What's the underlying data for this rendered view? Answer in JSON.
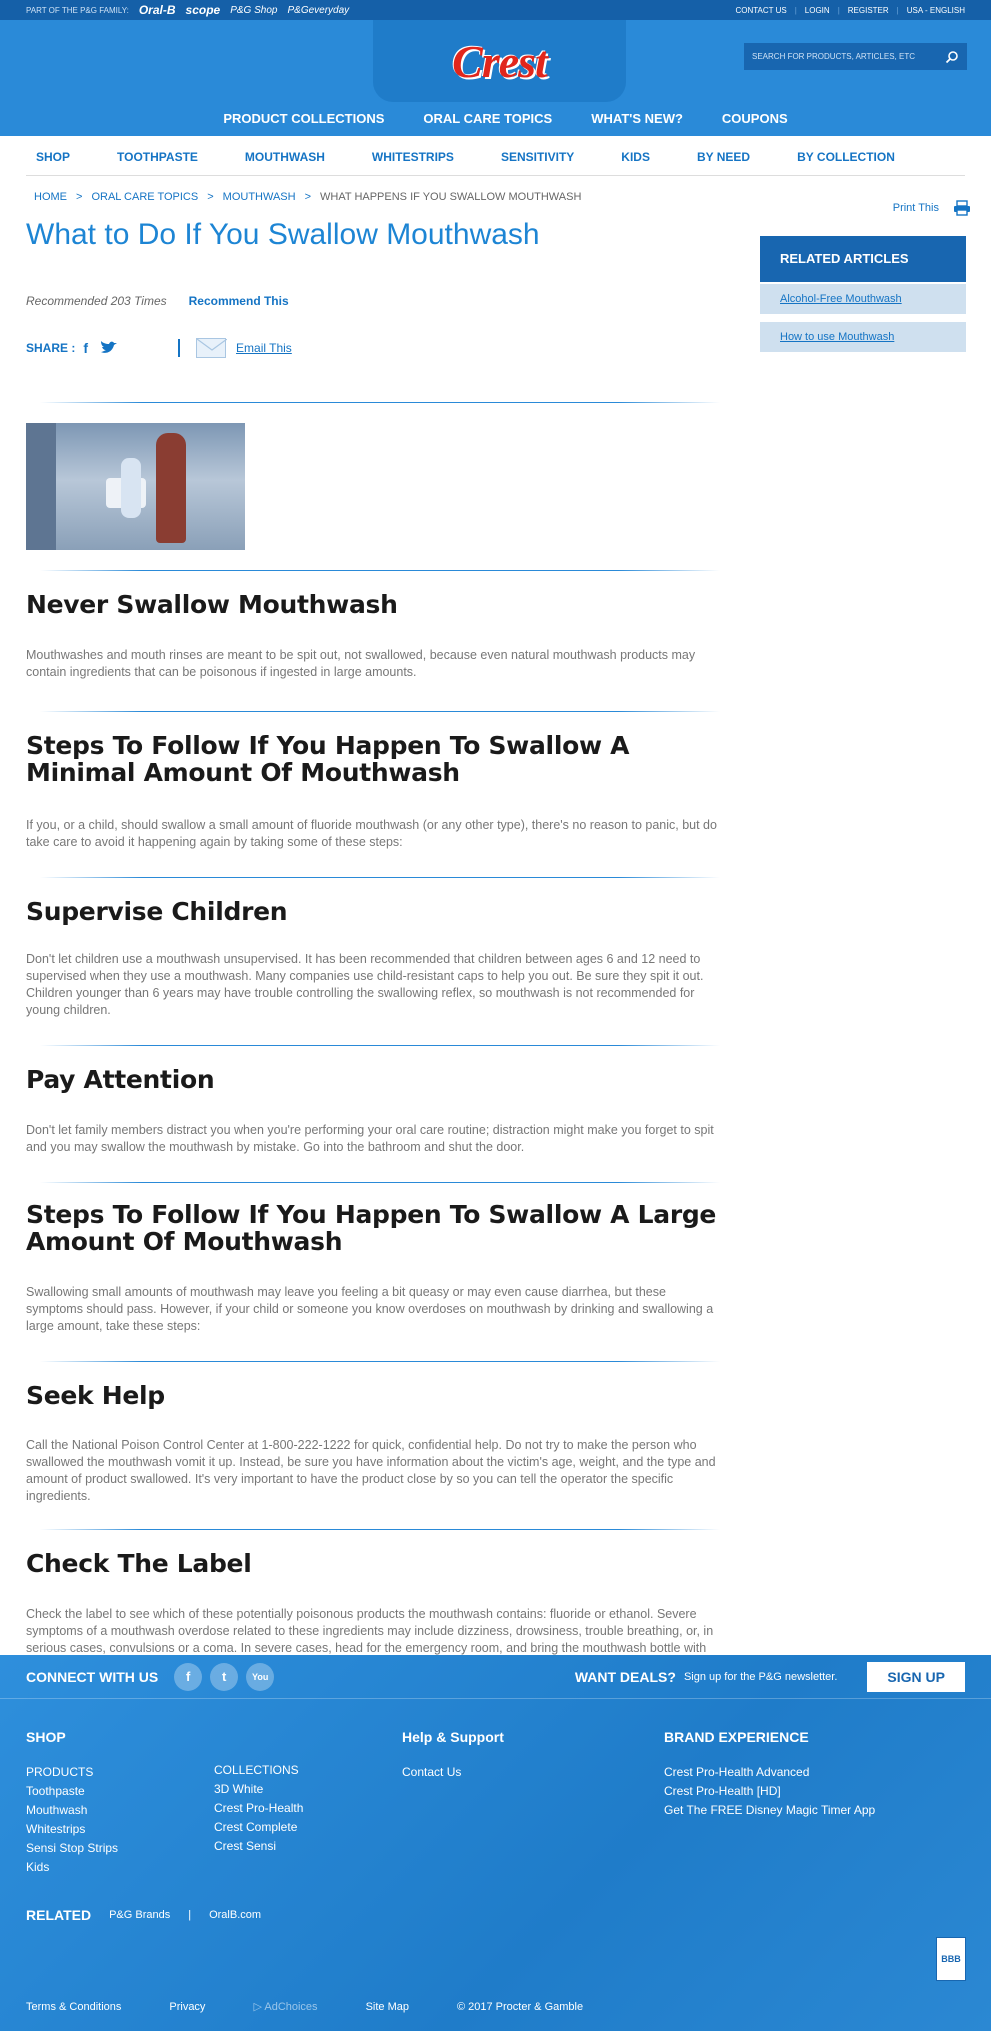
{
  "topbar": {
    "family_label": "PART OF THE P&G FAMILY:",
    "brands": [
      "Oral-B",
      "scope",
      "P&G Shop",
      "P&Geveryday"
    ],
    "links": [
      "CONTACT US",
      "LOGIN",
      "REGISTER",
      "USA - ENGLISH"
    ]
  },
  "header": {
    "logo": "Crest",
    "search_placeholder": "SEARCH FOR PRODUCTS, ARTICLES, ETC",
    "mainnav": [
      "PRODUCT COLLECTIONS",
      "ORAL CARE TOPICS",
      "WHAT'S NEW?",
      "COUPONS"
    ]
  },
  "subnav": [
    "SHOP",
    "TOOTHPASTE",
    "MOUTHWASH",
    "WHITESTRIPS",
    "SENSITIVITY",
    "KIDS",
    "BY NEED",
    "BY COLLECTION"
  ],
  "breadcrumb": {
    "items": [
      "HOME",
      "ORAL CARE TOPICS",
      "MOUTHWASH"
    ],
    "current": "WHAT HAPPENS IF YOU SWALLOW MOUTHWASH"
  },
  "print_label": "Print This",
  "article": {
    "title": "What to Do If You Swallow Mouthwash",
    "recommended": "Recommended 203 Times",
    "recommend_link": "Recommend This",
    "share_label": "SHARE :",
    "email_label": "Email This",
    "sections": [
      {
        "heading": "Never Swallow Mouthwash",
        "body": "Mouthwashes and mouth rinses are meant to be spit out, not swallowed, because even natural mouthwash products may contain ingredients that can be poisonous if ingested in large amounts."
      },
      {
        "heading": "Steps To Follow If You Happen To Swallow A Minimal Amount Of Mouthwash",
        "body": "If you, or a child, should swallow a small amount of fluoride mouthwash (or any other type), there's no reason to panic, but do take care to avoid it happening again by taking some of these steps:"
      },
      {
        "heading": "Supervise Children",
        "body": "Don't let children use a mouthwash unsupervised. It has been recommended that children between ages 6 and 12 need to supervised when they use a mouthwash. Many companies use child-resistant caps to help you out. Be sure they spit it out. Children younger than 6 years may have trouble controlling the swallowing reflex, so mouthwash is not recommended for young children."
      },
      {
        "heading": "Pay Attention",
        "body": "Don't let family members distract you when you're performing your oral care routine; distraction might make you forget to spit and you may swallow the mouthwash by mistake. Go into the bathroom and shut the door."
      },
      {
        "heading": "Steps To Follow If You Happen To Swallow A Large Amount Of Mouthwash",
        "body": "Swallowing small amounts of mouthwash may leave you feeling a bit queasy or may even cause diarrhea, but these symptoms should pass. However, if your child or someone you know overdoses on mouthwash by drinking and swallowing a large amount, take these steps:"
      },
      {
        "heading": "Seek Help",
        "body": "Call the National Poison Control Center at 1-800-222-1222 for quick, confidential help. Do not try to make the person who swallowed the mouthwash vomit it up. Instead, be sure you have information about the victim's age, weight, and the type and amount of product swallowed. It's very important to have the product close by so you can tell the operator the specific ingredients."
      },
      {
        "heading": "Check The Label",
        "body": "Check the label to see which of these potentially poisonous products the mouthwash contains: fluoride or ethanol. Severe symptoms of a mouthwash overdose related to these ingredients may include dizziness, drowsiness, trouble breathing, or, in serious cases, convulsions or a coma. In severe cases, head for the emergency room, and bring the mouthwash bottle with you if possible."
      }
    ]
  },
  "sidebar": {
    "title": "RELATED ARTICLES",
    "items": [
      "Alcohol-Free Mouthwash",
      "How to use Mouthwash"
    ]
  },
  "footer": {
    "connect": "CONNECT WITH US",
    "want_deals": "WANT DEALS?",
    "deals_text": "Sign up for the P&G newsletter.",
    "signup": "SIGN UP",
    "shop": {
      "title": "SHOP",
      "products_title": "PRODUCTS",
      "products": [
        "Toothpaste",
        "Mouthwash",
        "Whitestrips",
        "Sensi Stop Strips",
        "Kids"
      ],
      "collections_title": "COLLECTIONS",
      "collections": [
        "3D White",
        "Crest Pro-Health",
        "Crest Complete",
        "Crest Sensi"
      ]
    },
    "help": {
      "title": "Help & Support",
      "items": [
        "Contact Us"
      ]
    },
    "brand": {
      "title": "BRAND EXPERIENCE",
      "items": [
        "Crest Pro-Health Advanced",
        "Crest Pro-Health [HD]",
        "Get The FREE Disney Magic Timer App"
      ]
    },
    "related": {
      "title": "RELATED",
      "items": [
        "P&G Brands",
        "OralB.com"
      ]
    },
    "bbb": "BBB",
    "bottom": [
      "Terms & Conditions",
      "Privacy",
      "AdChoices",
      "Site Map",
      "© 2017 Procter & Gamble"
    ]
  },
  "colors": {
    "primary": "#2a8ad8",
    "dark": "#1866b0",
    "link": "#1574c4",
    "title": "#1d85d4",
    "logo": "#e1261c"
  }
}
